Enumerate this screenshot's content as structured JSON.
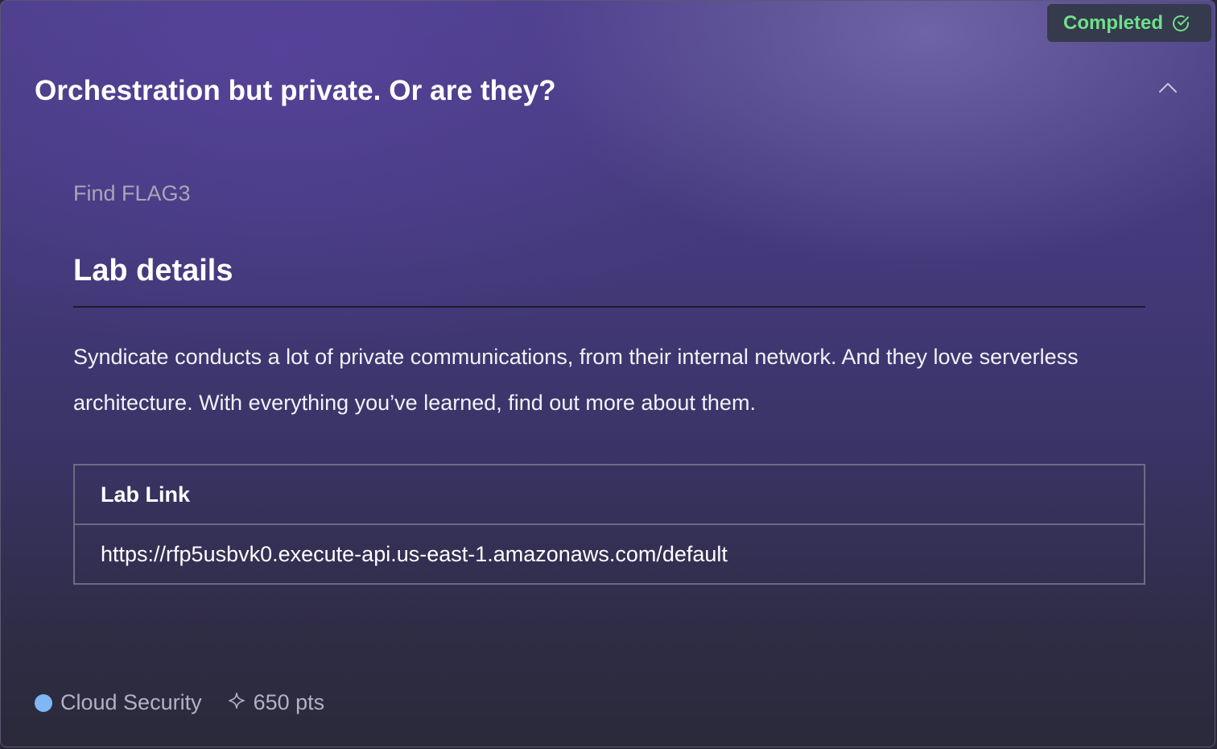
{
  "status": {
    "label": "Completed",
    "icon": "check-circle-icon",
    "color": "#6fe08a"
  },
  "challenge": {
    "title": "Orchestration but private. Or are they?",
    "collapse_icon": "chevron-up-icon",
    "subtitle": "Find FLAG3"
  },
  "lab_details": {
    "heading": "Lab details",
    "description": "Syndicate conducts a lot of private communications, from their internal network. And they love serverless architecture. With everything you’ve learned, find out more about them.",
    "table": {
      "header": "Lab Link",
      "link": "https://rfp5usbvk0.execute-api.us-east-1.amazonaws.com/default"
    }
  },
  "footer": {
    "category": "Cloud Security",
    "category_color": "#7fb6f5",
    "points_icon": "sparkle-icon",
    "points": "650 pts"
  }
}
